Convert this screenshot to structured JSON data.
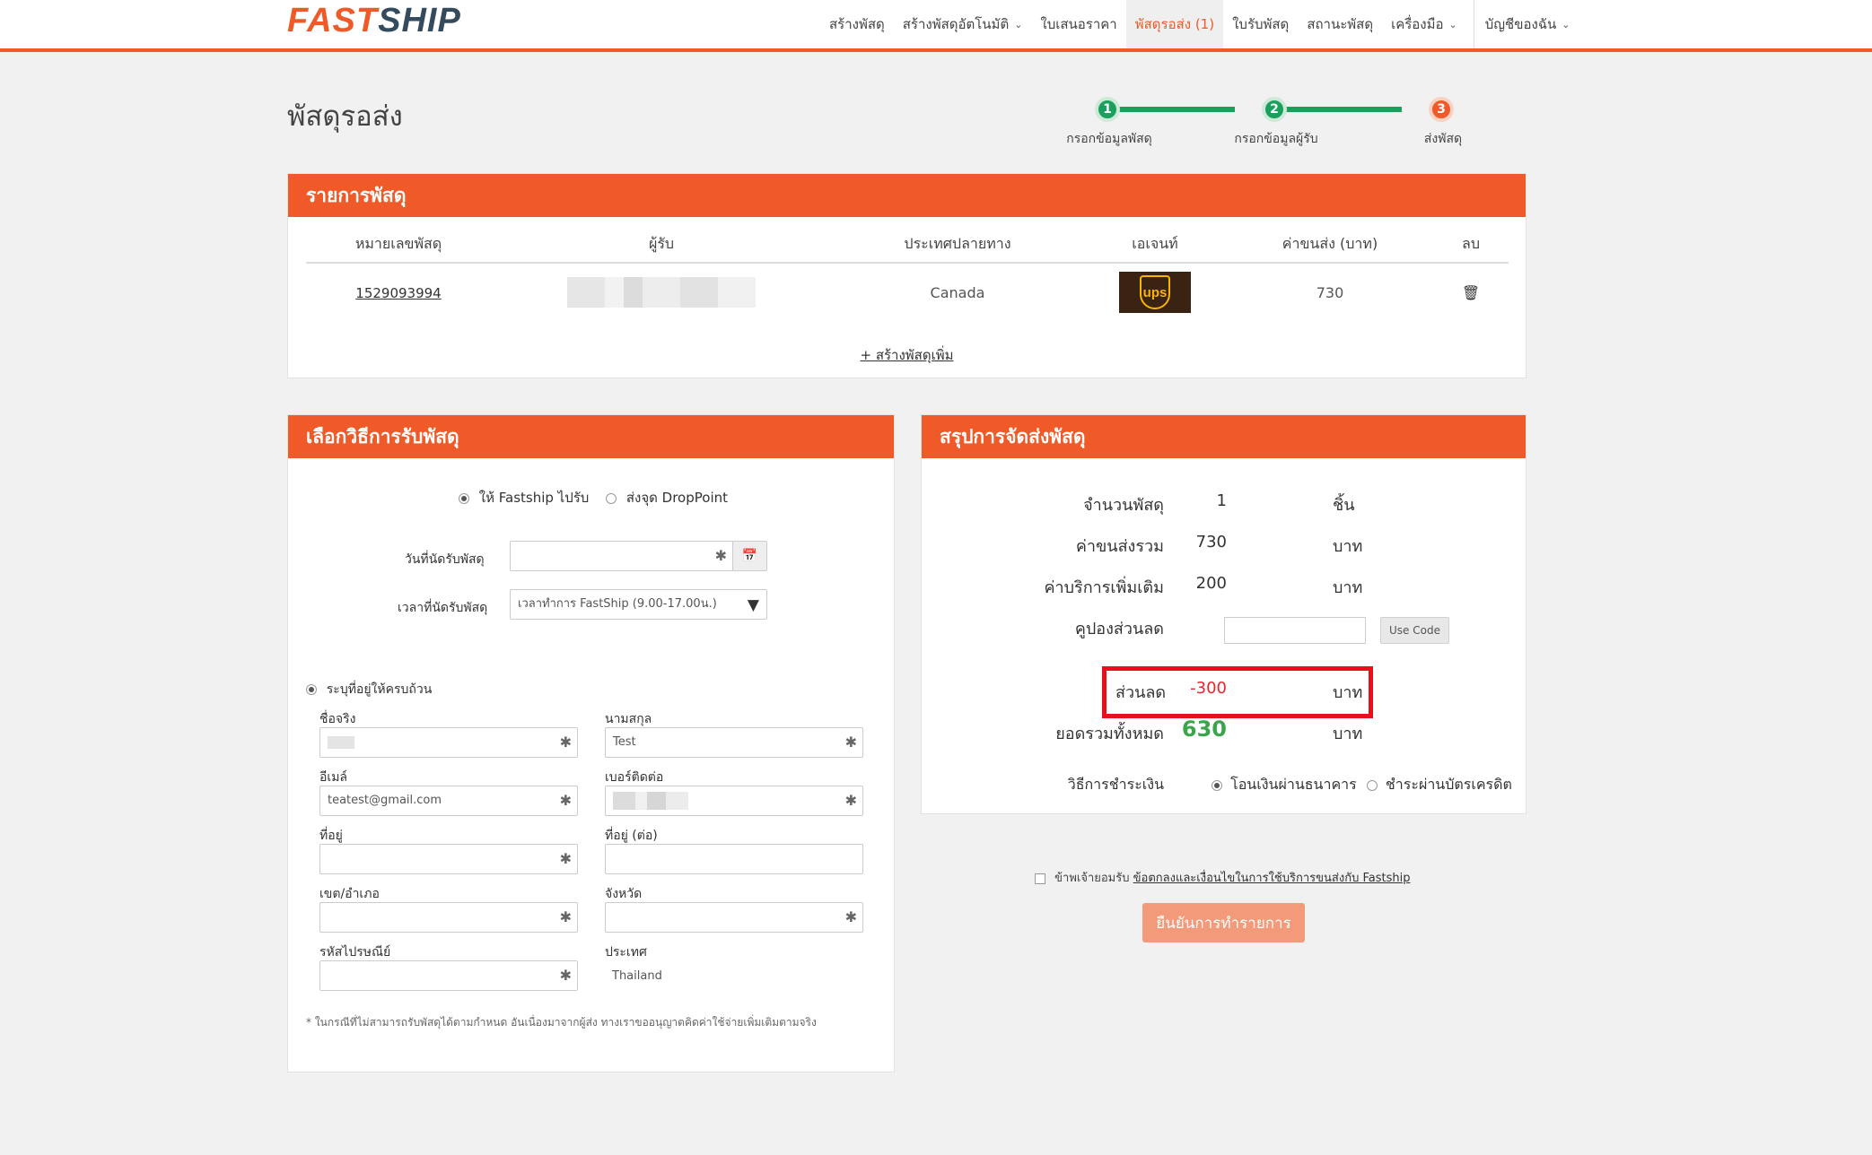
{
  "brand": {
    "logo_fast": "FAST",
    "logo_ship": "SHIP",
    "accent": "#f05a28",
    "success": "#1aa05d"
  },
  "nav": {
    "items": [
      {
        "label": "สร้างพัสดุ"
      },
      {
        "label": "สร้างพัสดุอัตโนมัติ"
      },
      {
        "label": "ใบเสนอราคา"
      },
      {
        "label": "พัสดุรอส่ง (1)"
      },
      {
        "label": "ใบรับพัสดุ"
      },
      {
        "label": "สถานะพัสดุ"
      },
      {
        "label": "เครื่องมือ"
      }
    ],
    "account": "บัญชีของฉัน"
  },
  "page": {
    "title": "พัสดุรอส่ง"
  },
  "stepper": {
    "steps": [
      {
        "num": "1",
        "label": "กรอกข้อมูลพัสดุ"
      },
      {
        "num": "2",
        "label": "กรอกข้อมูลผู้รับ"
      },
      {
        "num": "3",
        "label": "ส่งพัสดุ"
      }
    ]
  },
  "parcels": {
    "title": "รายการพัสดุ",
    "headers": [
      "หมายเลขพัสดุ",
      "ผู้รับ",
      "ประเทศปลายทาง",
      "เอเจนท์",
      "ค่าขนส่ง (บาท)",
      "ลบ"
    ],
    "rows": [
      {
        "tracking": "1529093994",
        "country": "Canada",
        "agent_icon": "ups-logo",
        "agent_text": "ups",
        "cost": "730"
      }
    ],
    "add_more": "+ สร้างพัสดุเพิ่ม"
  },
  "pickup": {
    "title": "เลือกวิธีการรับพัสดุ",
    "option_fastship": "ให้ Fastship ไปรับ",
    "option_droppoint": "ส่งจุด DropPoint",
    "date_label": "วันที่นัดรับพัสดุ",
    "time_label": "เวลาที่นัดรับพัสดุ",
    "time_value": "เวลาทำการ FastShip (9.00-17.00น.)",
    "address_option": "ระบุที่อยู่ให้ครบถ้วน",
    "fields": {
      "firstname_label": "ชื่อจริง",
      "lastname_label": "นามสกุล",
      "lastname_value": "Test",
      "email_label": "อีเมล์",
      "email_value": "teatest@gmail.com",
      "phone_label": "เบอร์ติดต่อ",
      "address_label": "ที่อยู่",
      "address2_label": "ที่อยู่ (ต่อ)",
      "district_label": "เขต/อำเภอ",
      "province_label": "จังหวัด",
      "postcode_label": "รหัสไปรษณีย์",
      "country_label": "ประเทศ",
      "country_value": "Thailand"
    },
    "footnote": "* ในกรณีที่ไม่สามารถรับพัสดุได้ตามกำหนด อันเนื่องมาจากผู้ส่ง ทางเราขออนุญาตคิดค่าใช้จ่ายเพิ่มเติมตามจริง"
  },
  "summary": {
    "title": "สรุปการจัดส่งพัสดุ",
    "count_label": "จำนวนพัสดุ",
    "count_value": "1",
    "count_unit": "ชิ้น",
    "shipping_label": "ค่าขนส่งรวม",
    "shipping_value": "730",
    "shipping_unit": "บาท",
    "extra_label": "ค่าบริการเพิ่มเติม",
    "extra_value": "200",
    "extra_unit": "บาท",
    "coupon_label": "คูปองส่วนลด",
    "coupon_button": "Use Code",
    "discount_label": "ส่วนลด",
    "discount_value": "-300",
    "discount_unit": "บาท",
    "total_label": "ยอดรวมทั้งหมด",
    "total_value": "630",
    "total_unit": "บาท",
    "payment_label": "วิธีการชำระเงิน",
    "payment_transfer": "โอนเงินผ่านธนาคาร",
    "payment_card": "ชำระผ่านบัตรเครดิต"
  },
  "terms": {
    "prefix": "ข้าพเจ้ายอมรับ",
    "link": "ข้อตกลงและเงื่อนไขในการใช้บริการขนส่งกับ Fastship"
  },
  "confirm_button": "ยืนยันการทำรายการ"
}
